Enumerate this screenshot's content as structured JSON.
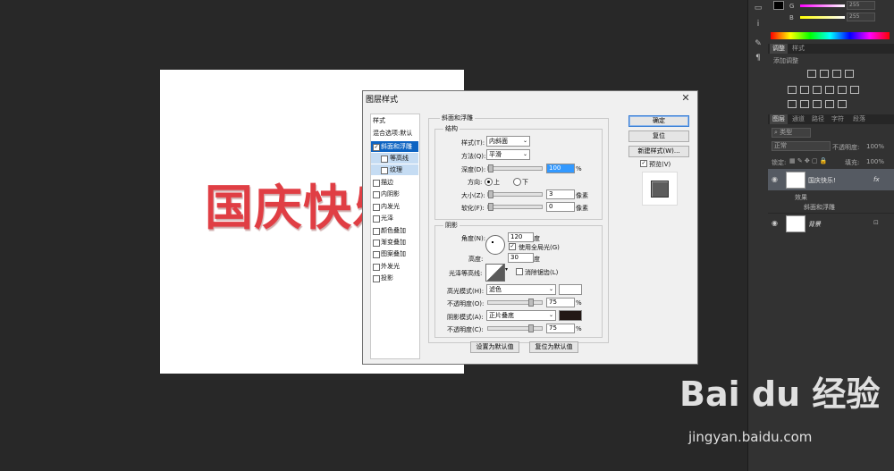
{
  "canvas": {
    "text": "国庆快乐"
  },
  "dialog": {
    "title": "图层样式",
    "close": "✕",
    "styles_header": "样式",
    "blend_options": "混合选项:默认",
    "style_items": [
      {
        "label": "斜面和浮雕",
        "checked": true
      },
      {
        "label": "等高线",
        "checked": false
      },
      {
        "label": "纹理",
        "checked": false
      },
      {
        "label": "描边",
        "checked": false
      },
      {
        "label": "内阴影",
        "checked": false
      },
      {
        "label": "内发光",
        "checked": false
      },
      {
        "label": "光泽",
        "checked": false
      },
      {
        "label": "颜色叠加",
        "checked": false
      },
      {
        "label": "渐变叠加",
        "checked": false
      },
      {
        "label": "图案叠加",
        "checked": false
      },
      {
        "label": "外发光",
        "checked": false
      },
      {
        "label": "投影",
        "checked": false
      }
    ],
    "bevel": {
      "group_title": "斜面和浮雕",
      "structure_title": "结构",
      "style_label": "样式(T):",
      "style_value": "内斜面",
      "technique_label": "方法(Q):",
      "technique_value": "平滑",
      "depth_label": "深度(D):",
      "depth_value": "100",
      "depth_unit": "%",
      "depth_fraction": 1.0,
      "direction_label": "方向:",
      "dir_up": "上",
      "dir_down": "下",
      "size_label": "大小(Z):",
      "size_value": "3",
      "size_unit": "像素",
      "soften_label": "软化(F):",
      "soften_value": "0",
      "soften_unit": "像素"
    },
    "shading": {
      "title": "阴影",
      "angle_label": "角度(N):",
      "angle_value": "120",
      "angle_unit": "度",
      "global_light_label": "使用全局光(G)",
      "global_light_checked": true,
      "altitude_label": "高度:",
      "altitude_value": "30",
      "altitude_unit": "度",
      "gloss_contour_label": "光泽等高线:",
      "anti_alias_label": "消除锯齿(L)",
      "highlight_mode_label": "高光模式(H):",
      "highlight_mode_value": "滤色",
      "highlight_color": "#ffffff",
      "highlight_opacity_label": "不透明度(O):",
      "highlight_opacity_value": "75",
      "shadow_mode_label": "阴影模式(A):",
      "shadow_mode_value": "正片叠底",
      "shadow_color": "#231815",
      "shadow_opacity_label": "不透明度(C):",
      "shadow_opacity_value": "75",
      "pct": "%"
    },
    "make_default": "设置为默认值",
    "reset_default": "复位为默认值",
    "ok": "确定",
    "reset": "复位",
    "new_style": "新建样式(W)...",
    "preview_label": "预览(V)",
    "preview_checked": true
  },
  "color_panel": {
    "g_label": "G",
    "g_value": "255",
    "b_label": "B",
    "b_value": "255"
  },
  "adjust_panel": {
    "tab_adjust": "调整",
    "tab_styles": "样式",
    "add_label": "添加调整"
  },
  "layers_panel": {
    "tabs": [
      "图层",
      "通道",
      "路径",
      "字符",
      "段落"
    ],
    "kind_label": "类型",
    "blend_mode": "正常",
    "opacity_label": "不透明度:",
    "opacity_value": "100%",
    "lock_label": "锁定:",
    "fill_label": "填充:",
    "fill_value": "100%",
    "layers": [
      {
        "name": "国庆快乐!",
        "fx": "fx"
      },
      {
        "name": "背景"
      }
    ],
    "effects_label": "效果",
    "effect_item": "斜面和浮雕"
  },
  "watermark": {
    "logo": "Bai du 经验",
    "url": "jingyan.baidu.com"
  },
  "colors": {
    "accent_blue": "#0c63c2",
    "text_red": "#e03e44",
    "dark_bg": "#282828"
  }
}
